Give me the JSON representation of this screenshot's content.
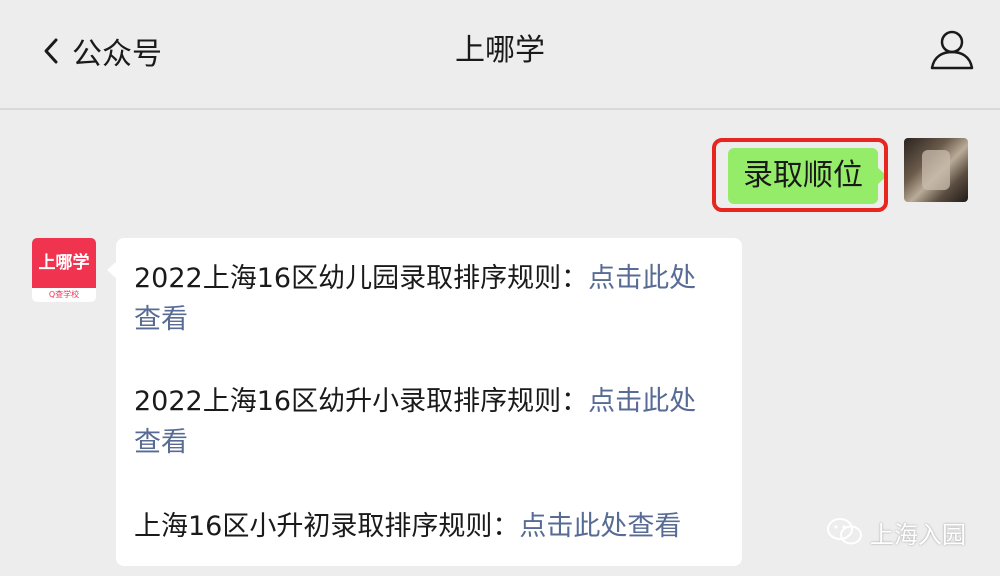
{
  "header": {
    "back_label": "公众号",
    "title": "上哪学"
  },
  "conversation": {
    "sent_message": "录取顺位",
    "bot_avatar": {
      "brand": "上哪学",
      "tagline": "Q查学校"
    },
    "reply": {
      "lines": [
        {
          "text": "2022上海16区幼儿园录取排序规则：",
          "link": "点击此处"
        },
        {
          "text": "",
          "link": "查看"
        },
        {
          "text": "2022上海16区幼升小录取排序规则：",
          "link": "点击此处"
        },
        {
          "text": "",
          "link": "查看"
        },
        {
          "text": "上海16区小升初录取排序规则：",
          "link": "点击此处查看"
        }
      ]
    }
  },
  "watermark": {
    "text": "上海入园"
  },
  "colors": {
    "background": "#ededed",
    "sent_bubble": "#95ec69",
    "highlight": "#e6261f",
    "link": "#576b95",
    "brand": "#f0334f"
  },
  "icons": {
    "back": "chevron-left-icon",
    "profile": "person-outline-icon",
    "watermark": "wechat-icon"
  }
}
